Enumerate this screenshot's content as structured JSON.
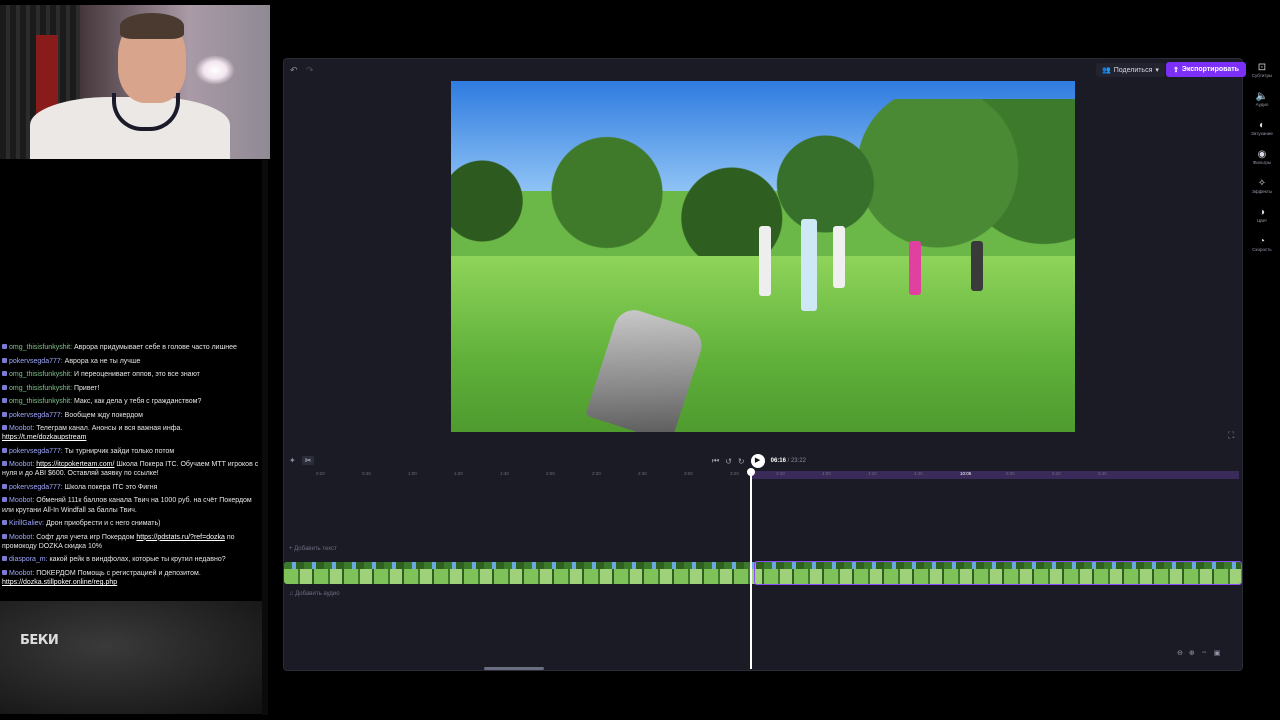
{
  "editor": {
    "share_label": "Поделиться",
    "export_label": "Экспортировать",
    "time_current": "06:16",
    "time_total": "/ 23:22",
    "add_text": "+ Добавить текст",
    "add_audio": "Добавить аудио",
    "ruler_ticks": [
      "0:20",
      "0:40",
      "1:00",
      "1:20",
      "1:40",
      "2:00",
      "2:20",
      "2:40",
      "3:00",
      "3:20",
      "3:40",
      "4:00",
      "4:20",
      "4:40",
      "10:05",
      "5:00",
      "5:20",
      "5:40"
    ],
    "accent_color": "#7b2ff7",
    "sidebar": [
      {
        "label": "Субтитры",
        "icon": "cc-icon"
      },
      {
        "label": "Аудио",
        "icon": "speaker-icon"
      },
      {
        "label": "Затухание",
        "icon": "fade-icon"
      },
      {
        "label": "Фильтры",
        "icon": "filter-icon"
      },
      {
        "label": "Эффекты",
        "icon": "wand-icon"
      },
      {
        "label": "Цвет",
        "icon": "color-icon"
      },
      {
        "label": "Скорость",
        "icon": "speed-icon"
      }
    ]
  },
  "chat": [
    {
      "user": "omg_thisisfunkyshit",
      "text": "Аврора придумывает себе в голове часто лишнее"
    },
    {
      "user": "pokervsegda777",
      "text": "Аврора ха не ты лучше"
    },
    {
      "user": "omg_thisisfunkyshit",
      "text": "И переоценивает оппов, это все знают"
    },
    {
      "user": "omg_thisisfunkyshit",
      "text": "Привет!"
    },
    {
      "user": "omg_thisisfunkyshit",
      "text": "Макс, как дела у тебя с гражданством?"
    },
    {
      "user": "pokervsegda777",
      "text": "Вообщем жду покердом"
    },
    {
      "user": "Moobot",
      "text": "Телеграм канал. Анонсы и вся важная инфа.",
      "link": "https://t.me/dozkaupstream",
      "after": ""
    },
    {
      "user": "pokervsegda777",
      "text": "Ты турнирчик зайди только потом"
    },
    {
      "user": "Moobot",
      "text": "",
      "link": "https://itcpokerteam.com/",
      "after": " Школа Покера ITC. Обучаем МТТ игроков с нуля и до ABI $600. Оставляй заявку по ссылке!"
    },
    {
      "user": "pokervsegda777",
      "text": "Школа покера ITC это Фигня"
    },
    {
      "user": "Moobot",
      "text": "Обменяй 111к баллов канала Твич на 1000 руб. на счёт Покердом или крутани All-In Windfall за баллы Твич."
    },
    {
      "user": "KirillGaliev",
      "text": "Дрон приобрести и с него снимать)"
    },
    {
      "user": "Moobot",
      "text": "Софт для учета игр Покердом",
      "link": "https://pdstats.ru/?ref=dozka",
      "after": " по промокоду DOZKA скидка 10%"
    },
    {
      "user": "diaspora_m",
      "text": "какой рейк в виндфолах, которые ты крутил недавно?"
    },
    {
      "user": "Moobot",
      "text": "ПОКЕРДОМ Помощь с регистрацией и депозитом.",
      "link": "https://dozka.stillpoker.online/reg.php",
      "after": ""
    }
  ],
  "overlay": {
    "label": "БЕКИ"
  }
}
